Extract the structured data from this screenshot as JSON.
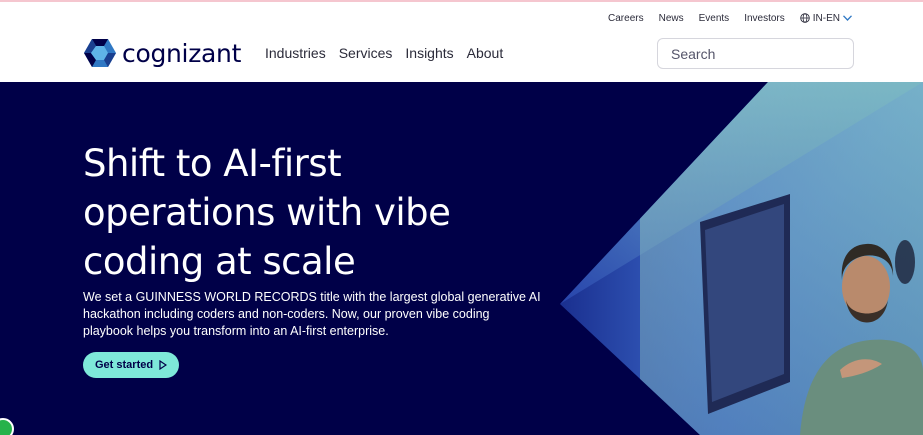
{
  "utility_nav": {
    "items": [
      "Careers",
      "News",
      "Events",
      "Investors"
    ],
    "language": "IN-EN"
  },
  "brand": {
    "name": "cognizant"
  },
  "main_nav": {
    "items": [
      "Industries",
      "Services",
      "Insights",
      "About"
    ]
  },
  "search": {
    "placeholder": "Search"
  },
  "hero": {
    "title": "Shift to AI-first operations with vibe coding at scale",
    "description": "We set a GUINNESS WORLD RECORDS title with the largest global generative AI hackathon including coders and non-coders. Now, our proven vibe coding playbook helps you transform into an AI-first enterprise.",
    "cta_label": "Get started"
  },
  "colors": {
    "brand_navy": "#000048",
    "cta_teal": "#7ee8d9",
    "accent_blue": "#2f78c4"
  }
}
